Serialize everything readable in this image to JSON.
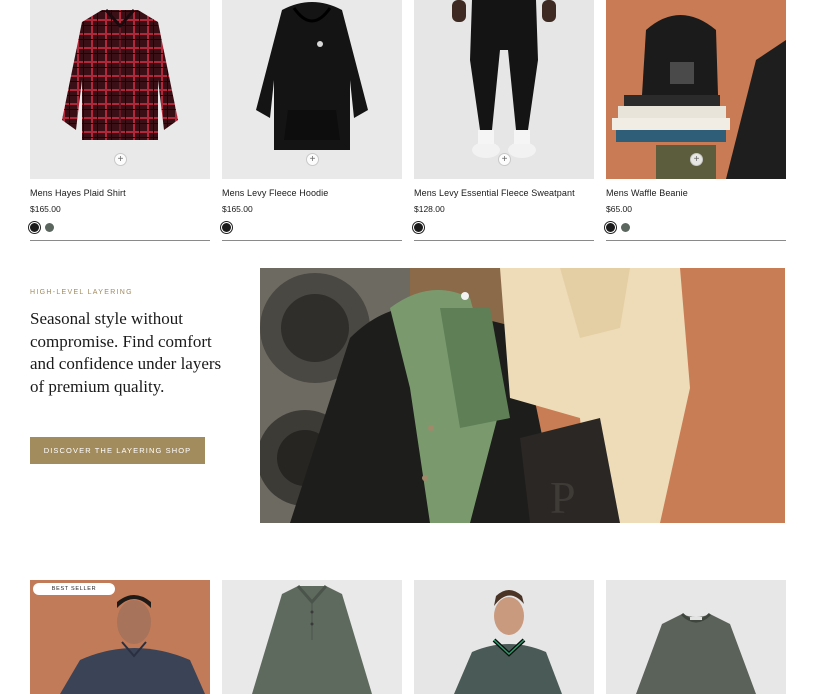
{
  "products_top": [
    {
      "name": "Mens Hayes Plaid Shirt",
      "price": "$165.00",
      "swatches": [
        "#1b1b1b",
        "#5b665f"
      ]
    },
    {
      "name": "Mens Levy Fleece Hoodie",
      "price": "$165.00",
      "swatches": [
        "#1b1b1b"
      ]
    },
    {
      "name": "Mens Levy Essential Fleece Sweatpant",
      "price": "$128.00",
      "swatches": [
        "#1b1b1b"
      ]
    },
    {
      "name": "Mens Waffle Beanie",
      "price": "$65.00",
      "swatches": [
        "#1b1b1b",
        "#5b665f"
      ]
    }
  ],
  "quick_add_symbol": "+",
  "promo": {
    "eyebrow": "HIGH-LEVEL LAYERING",
    "headline": "Seasonal style without compromise. Find comfort and confidence under layers of premium quality.",
    "cta_label": "DISCOVER THE LAYERING SHOP"
  },
  "products_bottom": [
    {
      "badge": "BEST SELLER"
    },
    {},
    {},
    {}
  ],
  "colors": {
    "accent": "#a28c5e",
    "eyebrow": "#a08a5e",
    "rule": "#8a8a8a"
  },
  "icons": [
    "plus-icon"
  ]
}
